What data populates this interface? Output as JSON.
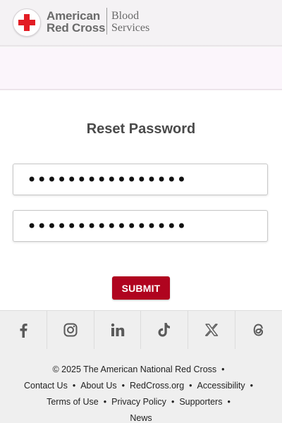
{
  "header": {
    "brand_line1": "American",
    "brand_line2": "Red Cross",
    "services_line1": "Blood",
    "services_line2": "Services",
    "brand_color": "#e21c24"
  },
  "main": {
    "title": "Reset Password",
    "password_value": "password12345678",
    "confirm_password_value": "password12345678",
    "submit_label": "SUBMIT",
    "accent": "#b0041f"
  },
  "social": {
    "icons": [
      "facebook-icon",
      "instagram-icon",
      "linkedin-icon",
      "tiktok-icon",
      "x-icon",
      "threads-icon"
    ]
  },
  "footer": {
    "copyright": "© 2025 The American National Red Cross",
    "links": {
      "contact": "Contact Us",
      "about": "About Us",
      "redcross": "RedCross.org",
      "accessibility": "Accessibility",
      "terms": "Terms of Use",
      "privacy": "Privacy Policy",
      "supporters": "Supporters",
      "news": "News"
    },
    "separator": "•"
  }
}
